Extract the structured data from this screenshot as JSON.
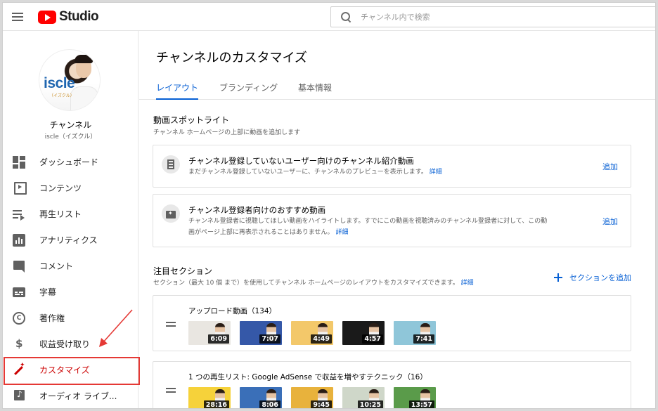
{
  "header": {
    "logo_text": "Studio",
    "search_placeholder": "チャンネル内で検索"
  },
  "sidebar": {
    "avatar_brand": "iscle",
    "avatar_brand_sub": "（イズクル）",
    "channel_name": "チャンネル",
    "channel_handle": "iscle（イズクル）",
    "items": [
      {
        "label": "ダッシュボード",
        "icon": "dashboard-icon"
      },
      {
        "label": "コンテンツ",
        "icon": "content-icon"
      },
      {
        "label": "再生リスト",
        "icon": "playlist-icon"
      },
      {
        "label": "アナリティクス",
        "icon": "analytics-icon"
      },
      {
        "label": "コメント",
        "icon": "comment-icon"
      },
      {
        "label": "字幕",
        "icon": "subtitles-icon"
      },
      {
        "label": "著作権",
        "icon": "copyright-icon"
      },
      {
        "label": "収益受け取り",
        "icon": "dollar-icon"
      },
      {
        "label": "カスタマイズ",
        "icon": "magic-wand-icon",
        "active": true
      },
      {
        "label": "オーディオ ライブ...",
        "icon": "audio-library-icon"
      }
    ]
  },
  "main": {
    "title": "チャンネルのカスタマイズ",
    "tabs": [
      "レイアウト",
      "ブランディング",
      "基本情報"
    ],
    "active_tab": "レイアウト",
    "spotlight": {
      "title": "動画スポットライト",
      "subtitle": "チャンネル ホームページの上部に動画を追加します",
      "cards": [
        {
          "title": "チャンネル登録していないユーザー向けのチャンネル紹介動画",
          "desc_line1": "まだチャンネル登録していないユーザーに、チャンネルのプレビューを表示します。",
          "desc_line2": "",
          "link": "詳細",
          "action": "追加"
        },
        {
          "title": "チャンネル登録者向けのおすすめ動画",
          "desc_line1": "チャンネル登録者に視聴してほしい動画をハイライトします。すでにこの動画を視聴済みのチャンネル登録者に対して、この動",
          "desc_line2": "画がページ上部に再表示されることはありません。",
          "link": "詳細",
          "action": "追加"
        }
      ]
    },
    "featured": {
      "title": "注目セクション",
      "subtitle": "セクション（最大 10 個 まで）を使用してチャンネル ホームページのレイアウトをカスタマイズできます。",
      "link": "詳細",
      "add_section": "セクションを追加",
      "sections": [
        {
          "title": "アップロード動画（134）",
          "durations": [
            "6:09",
            "7:07",
            "4:49",
            "4:57",
            "7:41"
          ],
          "colors": [
            "#e9e6e1",
            "#3558a8",
            "#f3c86a",
            "#1a1a1a",
            "#8fc6d9"
          ]
        },
        {
          "title": "1 つの再生リスト: Google AdSense で収益を増やすテクニック（16）",
          "durations": [
            "28:16",
            "8:06",
            "9:45",
            "10:25",
            "13:57"
          ],
          "colors": [
            "#f6d23a",
            "#3a6fb8",
            "#e8b23c",
            "#cfd7c9",
            "#5a9b4a"
          ]
        }
      ]
    }
  },
  "annotation": {
    "highlight_color": "#e53935"
  }
}
